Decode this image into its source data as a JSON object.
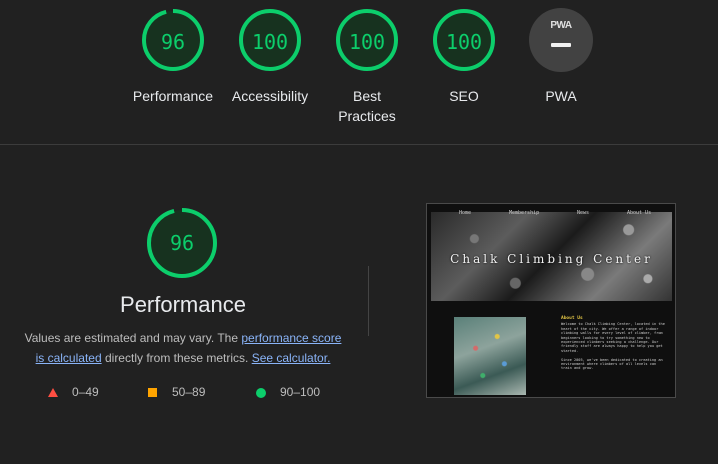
{
  "summary": {
    "gauges": [
      {
        "score": "96",
        "label": "Performance"
      },
      {
        "score": "100",
        "label": "Accessibility"
      },
      {
        "score": "100",
        "label": "Best Practices"
      },
      {
        "score": "100",
        "label": "SEO"
      }
    ],
    "pwa": {
      "badge_text": "PWA",
      "label": "PWA"
    }
  },
  "performance": {
    "score": "96",
    "title": "Performance",
    "desc_prefix": "Values are estimated and may vary. The ",
    "score_link": "performance score is calculated",
    "desc_middle": " directly from these metrics. ",
    "calculator_link": "See calculator."
  },
  "legend": {
    "fail": "0–49",
    "average": "50–89",
    "pass": "90–100"
  },
  "colors": {
    "pass": "#0cce6b",
    "average": "#ffa400",
    "fail": "#ff4e42",
    "link": "#8ab4f8"
  },
  "thumbnail": {
    "nav": [
      "Home",
      "Membership",
      "News",
      "About Us"
    ],
    "hero_title": "Chalk Climbing Center",
    "about_heading": "About Us",
    "about_p1": "Welcome to Chalk Climbing Center, located in the heart of the city. We offer a range of indoor climbing walls for every level of climber, from beginners looking to try something new to experienced climbers seeking a challenge. Our friendly staff are always happy to help you get started.",
    "about_p2": "Since 2005, we've been dedicated to creating an environment where climbers of all levels can train and grow."
  }
}
